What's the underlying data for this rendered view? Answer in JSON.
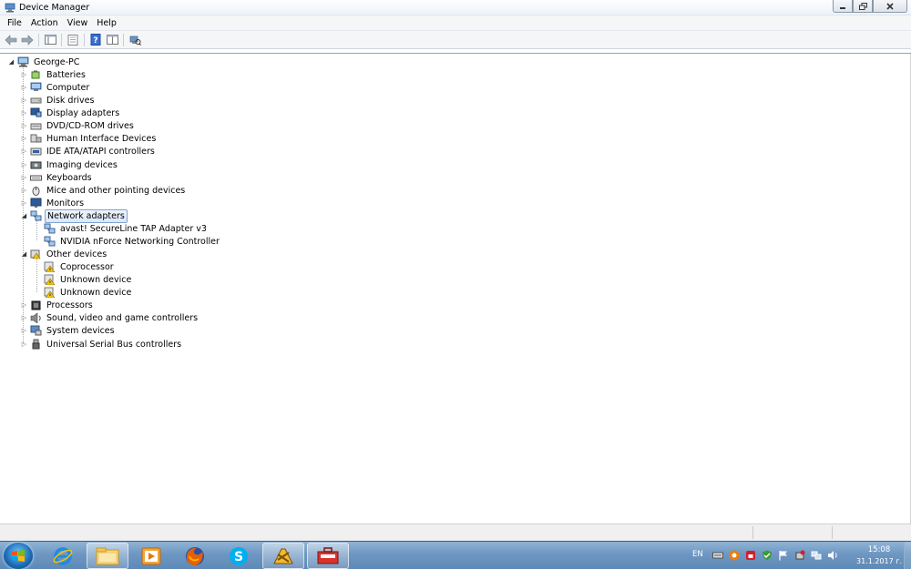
{
  "window": {
    "title": "Device Manager",
    "minimize": "0",
    "maximize": "1",
    "close": "r"
  },
  "menu": [
    "File",
    "Action",
    "View",
    "Help"
  ],
  "toolbar": {
    "buttons": [
      "back-arrow-icon",
      "forward-arrow-icon",
      "console-tree-icon",
      "properties-icon",
      "help-icon",
      "update-driver-icon",
      "scan-hardware-icon"
    ]
  },
  "tree": {
    "root": "George-PC",
    "nodes": [
      {
        "label": "Batteries",
        "icon": "battery-icon",
        "expanded": false
      },
      {
        "label": "Computer",
        "icon": "computer-icon",
        "expanded": false
      },
      {
        "label": "Disk drives",
        "icon": "disk-drive-icon",
        "expanded": false
      },
      {
        "label": "Display adapters",
        "icon": "display-adapter-icon",
        "expanded": false
      },
      {
        "label": "DVD/CD-ROM drives",
        "icon": "dvd-drive-icon",
        "expanded": false
      },
      {
        "label": "Human Interface Devices",
        "icon": "hid-icon",
        "expanded": false
      },
      {
        "label": "IDE ATA/ATAPI controllers",
        "icon": "ide-controller-icon",
        "expanded": false
      },
      {
        "label": "Imaging devices",
        "icon": "camera-icon",
        "expanded": false
      },
      {
        "label": "Keyboards",
        "icon": "keyboard-icon",
        "expanded": false
      },
      {
        "label": "Mice and other pointing devices",
        "icon": "mouse-icon",
        "expanded": false
      },
      {
        "label": "Monitors",
        "icon": "monitor-icon",
        "expanded": false
      },
      {
        "label": "Network adapters",
        "icon": "network-adapter-icon",
        "expanded": true,
        "selected": true,
        "children": [
          "avast! SecureLine TAP Adapter v3",
          "NVIDIA nForce Networking Controller"
        ]
      },
      {
        "label": "Other devices",
        "icon": "other-devices-icon",
        "expanded": true,
        "children": [
          "Coprocessor",
          "Unknown device",
          "Unknown device"
        ]
      },
      {
        "label": "Processors",
        "icon": "processor-icon",
        "expanded": false
      },
      {
        "label": "Sound, video and game controllers",
        "icon": "speaker-icon",
        "expanded": false
      },
      {
        "label": "System devices",
        "icon": "system-devices-icon",
        "expanded": false
      },
      {
        "label": "Universal Serial Bus controllers",
        "icon": "usb-icon",
        "expanded": false
      }
    ]
  },
  "taskbar": {
    "apps": [
      "internet-explorer-icon",
      "file-explorer-icon",
      "media-player-icon",
      "firefox-icon",
      "skype-icon",
      "winamp-icon",
      "device-manager-icon"
    ],
    "language": "EN",
    "time": "15:08",
    "date": "31.1.2017 г."
  },
  "colors": {
    "selection_border": "#7da2ce",
    "taskbar": "#6e97c2",
    "warning": "#f2c400"
  }
}
